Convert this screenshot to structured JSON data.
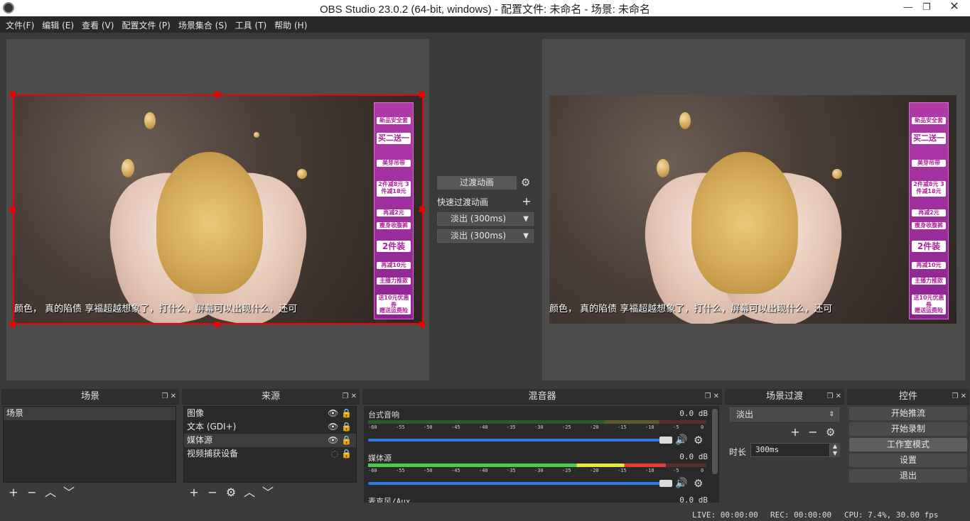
{
  "window": {
    "title": "OBS Studio 23.0.2 (64-bit, windows) - 配置文件: 未命名 - 场景: 未命名"
  },
  "menu": [
    "文件(F)",
    "编辑 (E)",
    "查看 (V)",
    "配置文件 (P)",
    "场景集合 (S)",
    "工具 (T)",
    "帮助 (H)"
  ],
  "preview": {
    "subtitle": "颜色， 真的陷债 享福超越想象了，打什么，屏幕可以出现什么，还可",
    "ads": [
      "新品安全套",
      "买二送一",
      "美芽吊带",
      "2件减8元 3件减18元",
      "再减2元",
      "瘦身收腹裤",
      "2件装",
      "再减10元",
      "主播力推款",
      "送10元优惠券",
      "赠送运费险"
    ]
  },
  "transitions": {
    "button": "过渡动画",
    "quick_label": "快速过渡动画",
    "fade1": "淡出 (300ms)",
    "fade2": "淡出 (300ms)"
  },
  "docks": {
    "scenes": {
      "title": "场景",
      "items": [
        "场景"
      ]
    },
    "sources": {
      "title": "来源",
      "items": [
        "图像",
        "文本 (GDI+)",
        "媒体源",
        "视频捕获设备"
      ]
    },
    "mixer": {
      "title": "混音器",
      "tracks": [
        {
          "name": "台式音响",
          "db": "0.0 dB"
        },
        {
          "name": "媒体源",
          "db": "0.0 dB"
        },
        {
          "name": "麦克风/Aux",
          "db": "0.0 dB"
        }
      ],
      "ticks": [
        "-60",
        "-55",
        "-50",
        "-45",
        "-40",
        "-35",
        "-30",
        "-25",
        "-20",
        "-15",
        "-10",
        "-5",
        "0"
      ]
    },
    "scene_transitions": {
      "title": "场景过渡",
      "selected": "淡出",
      "duration_label": "时长",
      "duration": "300ms"
    },
    "controls": {
      "title": "控件",
      "buttons": [
        "开始推流",
        "开始录制",
        "工作室模式",
        "设置",
        "退出"
      ]
    }
  },
  "status": {
    "live": "LIVE: 00:00:00",
    "rec": "REC: 00:00:00",
    "cpu": "CPU: 7.4%, 30.00 fps"
  }
}
